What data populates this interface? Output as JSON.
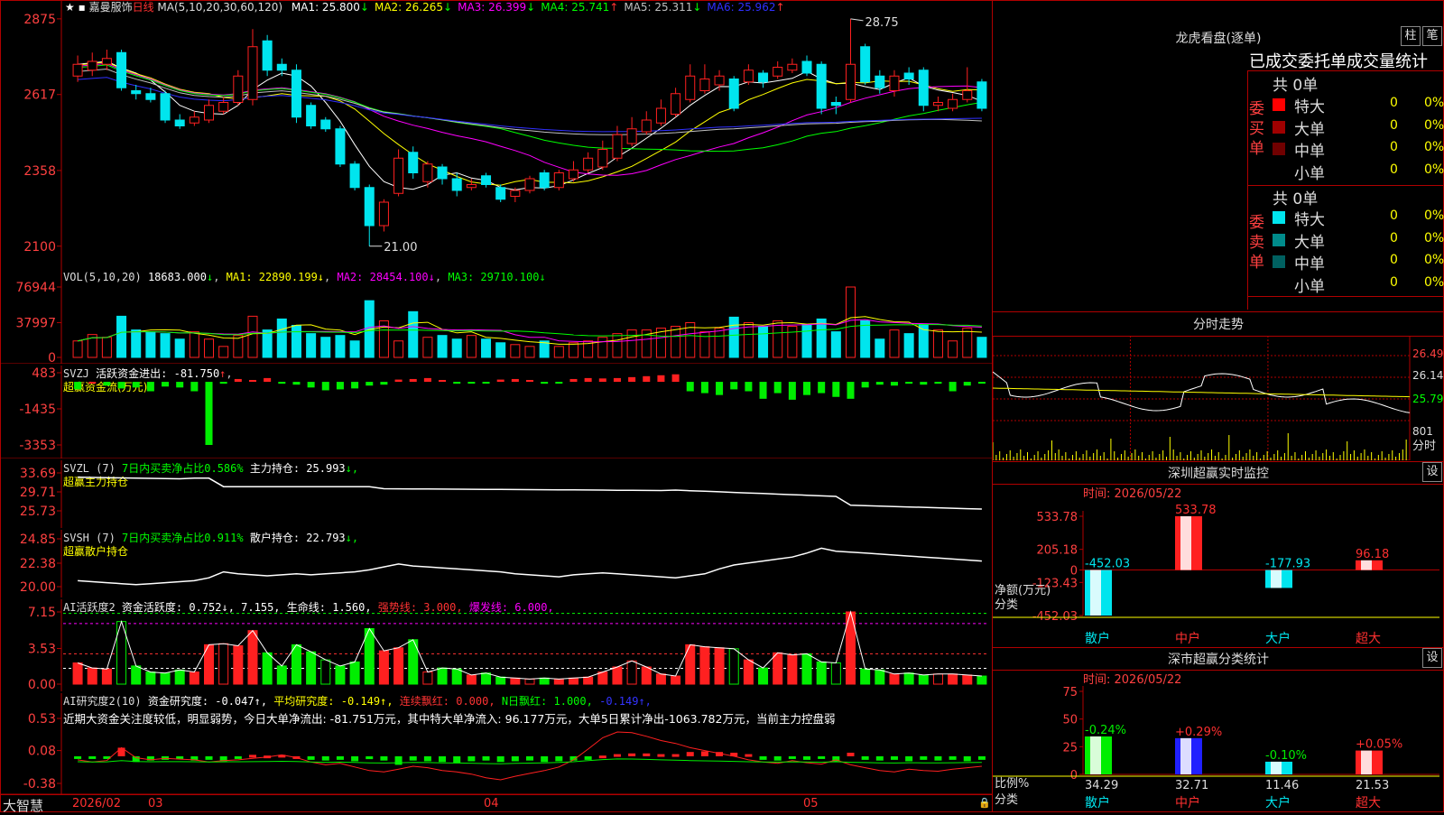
{
  "app": {
    "brand": "大智慧",
    "stock_name": "嘉曼服饰",
    "period": "日线"
  },
  "main_chart": {
    "ma_line": {
      "prefix": "MA(5,10,20,30,60,120)",
      "items": [
        {
          "label": "MA1:",
          "value": "25.800",
          "arrow": "↓",
          "color": "#ffffff"
        },
        {
          "label": "MA2:",
          "value": "26.265",
          "arrow": "↓",
          "color": "#ffff00"
        },
        {
          "label": "MA3:",
          "value": "26.399",
          "arrow": "↓",
          "color": "#ff00ff"
        },
        {
          "label": "MA4:",
          "value": "25.741",
          "arrow": "↑",
          "color": "#00ff00"
        },
        {
          "label": "MA5:",
          "value": "25.311",
          "arrow": "↓",
          "color": "#c0c0c0"
        },
        {
          "label": "MA6:",
          "value": "25.962",
          "arrow": "↑",
          "color": "#3030ff"
        }
      ]
    },
    "y_ticks": [
      "2875",
      "2617",
      "2358",
      "2100"
    ],
    "high_label": "28.75",
    "low_label": "21.00"
  },
  "chart_data": [
    {
      "type": "candlestick",
      "title": "嘉曼服饰 日线",
      "ylim": [
        21.0,
        28.75
      ],
      "high": 28.75,
      "low": 21.0,
      "candles": [
        {
          "o": 26.8,
          "c": 27.2,
          "h": 27.5,
          "l": 26.6
        },
        {
          "o": 27.0,
          "c": 27.3,
          "h": 27.6,
          "l": 26.8
        },
        {
          "o": 27.2,
          "c": 27.4,
          "h": 27.7,
          "l": 27.0
        },
        {
          "o": 27.6,
          "c": 26.4,
          "h": 27.7,
          "l": 26.3
        },
        {
          "o": 26.3,
          "c": 26.2,
          "h": 26.5,
          "l": 26.0
        },
        {
          "o": 26.2,
          "c": 26.0,
          "h": 26.4,
          "l": 25.9
        },
        {
          "o": 26.2,
          "c": 25.3,
          "h": 26.3,
          "l": 25.2
        },
        {
          "o": 25.3,
          "c": 25.1,
          "h": 25.5,
          "l": 25.0
        },
        {
          "o": 25.2,
          "c": 25.4,
          "h": 25.6,
          "l": 25.1
        },
        {
          "o": 25.3,
          "c": 25.8,
          "h": 26.0,
          "l": 25.2
        },
        {
          "o": 25.6,
          "c": 25.9,
          "h": 26.1,
          "l": 25.5
        },
        {
          "o": 25.9,
          "c": 26.8,
          "h": 27.0,
          "l": 25.8
        },
        {
          "o": 26.0,
          "c": 27.8,
          "h": 28.4,
          "l": 25.8
        },
        {
          "o": 28.0,
          "c": 27.0,
          "h": 28.2,
          "l": 26.8
        },
        {
          "o": 27.2,
          "c": 27.0,
          "h": 27.4,
          "l": 26.8
        },
        {
          "o": 27.0,
          "c": 25.4,
          "h": 27.2,
          "l": 25.2
        },
        {
          "o": 25.8,
          "c": 25.1,
          "h": 25.9,
          "l": 25.0
        },
        {
          "o": 25.3,
          "c": 25.0,
          "h": 25.4,
          "l": 24.9
        },
        {
          "o": 25.0,
          "c": 23.8,
          "h": 25.1,
          "l": 23.7
        },
        {
          "o": 23.8,
          "c": 23.0,
          "h": 23.9,
          "l": 22.9
        },
        {
          "o": 23.0,
          "c": 21.7,
          "h": 23.1,
          "l": 21.0
        },
        {
          "o": 21.7,
          "c": 22.5,
          "h": 22.6,
          "l": 21.5
        },
        {
          "o": 22.8,
          "c": 24.0,
          "h": 24.3,
          "l": 22.7
        },
        {
          "o": 24.2,
          "c": 23.5,
          "h": 24.4,
          "l": 23.3
        },
        {
          "o": 23.2,
          "c": 23.8,
          "h": 23.9,
          "l": 23.0
        },
        {
          "o": 23.7,
          "c": 23.3,
          "h": 23.8,
          "l": 23.1
        },
        {
          "o": 23.3,
          "c": 22.9,
          "h": 23.5,
          "l": 22.7
        },
        {
          "o": 23.0,
          "c": 23.1,
          "h": 23.3,
          "l": 22.9
        },
        {
          "o": 23.4,
          "c": 23.1,
          "h": 23.5,
          "l": 23.0
        },
        {
          "o": 23.0,
          "c": 22.6,
          "h": 23.1,
          "l": 22.5
        },
        {
          "o": 22.7,
          "c": 22.9,
          "h": 23.0,
          "l": 22.5
        },
        {
          "o": 22.9,
          "c": 23.3,
          "h": 23.4,
          "l": 22.8
        },
        {
          "o": 23.5,
          "c": 23.0,
          "h": 23.6,
          "l": 22.9
        },
        {
          "o": 23.0,
          "c": 23.5,
          "h": 23.6,
          "l": 22.9
        },
        {
          "o": 23.3,
          "c": 23.6,
          "h": 23.9,
          "l": 23.2
        },
        {
          "o": 23.6,
          "c": 24.0,
          "h": 24.2,
          "l": 23.5
        },
        {
          "o": 23.7,
          "c": 24.3,
          "h": 24.6,
          "l": 23.6
        },
        {
          "o": 24.0,
          "c": 24.8,
          "h": 25.1,
          "l": 23.9
        },
        {
          "o": 24.5,
          "c": 25.0,
          "h": 25.4,
          "l": 24.4
        },
        {
          "o": 24.9,
          "c": 25.3,
          "h": 25.6,
          "l": 24.8
        },
        {
          "o": 25.2,
          "c": 25.7,
          "h": 26.0,
          "l": 25.1
        },
        {
          "o": 25.5,
          "c": 26.2,
          "h": 26.4,
          "l": 25.4
        },
        {
          "o": 26.0,
          "c": 26.8,
          "h": 27.2,
          "l": 25.9
        },
        {
          "o": 26.3,
          "c": 26.7,
          "h": 27.2,
          "l": 26.2
        },
        {
          "o": 26.5,
          "c": 26.8,
          "h": 27.0,
          "l": 26.3
        },
        {
          "o": 26.7,
          "c": 25.7,
          "h": 26.8,
          "l": 25.6
        },
        {
          "o": 26.6,
          "c": 27.0,
          "h": 27.2,
          "l": 26.5
        },
        {
          "o": 26.9,
          "c": 26.6,
          "h": 27.0,
          "l": 26.4
        },
        {
          "o": 26.8,
          "c": 27.1,
          "h": 27.3,
          "l": 26.7
        },
        {
          "o": 27.0,
          "c": 27.2,
          "h": 27.4,
          "l": 26.9
        },
        {
          "o": 27.3,
          "c": 26.9,
          "h": 27.5,
          "l": 26.8
        },
        {
          "o": 27.2,
          "c": 25.7,
          "h": 27.3,
          "l": 25.5
        },
        {
          "o": 25.9,
          "c": 25.8,
          "h": 26.1,
          "l": 25.5
        },
        {
          "o": 26.0,
          "c": 27.2,
          "h": 28.75,
          "l": 25.9
        },
        {
          "o": 27.8,
          "c": 26.6,
          "h": 27.9,
          "l": 26.5
        },
        {
          "o": 26.8,
          "c": 26.4,
          "h": 27.0,
          "l": 26.2
        },
        {
          "o": 26.3,
          "c": 26.8,
          "h": 27.0,
          "l": 26.1
        },
        {
          "o": 26.9,
          "c": 26.7,
          "h": 27.1,
          "l": 26.5
        },
        {
          "o": 27.0,
          "c": 25.8,
          "h": 27.1,
          "l": 25.6
        },
        {
          "o": 25.8,
          "c": 25.9,
          "h": 26.1,
          "l": 25.6
        },
        {
          "o": 25.7,
          "c": 26.0,
          "h": 26.2,
          "l": 25.6
        },
        {
          "o": 26.0,
          "c": 26.3,
          "h": 27.1,
          "l": 25.9
        },
        {
          "o": 26.6,
          "c": 25.7,
          "h": 26.7,
          "l": 25.6
        }
      ]
    },
    {
      "type": "bar",
      "title": "VOL(5,10,20)",
      "ylim": [
        0,
        76944
      ],
      "values": [
        18000,
        25000,
        22000,
        45000,
        30000,
        28000,
        26000,
        20000,
        28000,
        20000,
        12000,
        24000,
        45000,
        30000,
        42000,
        35000,
        26000,
        22000,
        24000,
        18000,
        62000,
        40000,
        18000,
        50000,
        22000,
        24000,
        20000,
        24000,
        20000,
        16000,
        14000,
        12000,
        18000,
        12000,
        16000,
        18000,
        22000,
        26000,
        30000,
        30000,
        32000,
        34000,
        38000,
        28000,
        32000,
        44000,
        38000,
        34000,
        40000,
        34000,
        36000,
        42000,
        28000,
        76944,
        40000,
        20000,
        30000,
        26000,
        36000,
        30000,
        18000,
        32000,
        22000
      ]
    }
  ],
  "vol_panel": {
    "label": "VOL(5,10,20)",
    "value": "18683.000",
    "arrow": "↓",
    "ma1": "MA1: 22890.199↓",
    "ma2": "MA2: 28454.100↓",
    "ma3": "MA3: 29710.100↓",
    "y_ticks": [
      "76944",
      "37997",
      "0"
    ]
  },
  "svzj_panel": {
    "label": "SVZJ",
    "text": "活跃资金进出: -81.750",
    "arrow": "↑",
    "sub": "超赢资金流(万元)",
    "y_ticks": [
      "483",
      "-1435",
      "-3353"
    ],
    "values": [
      -400,
      0,
      -200,
      -350,
      -300,
      -500,
      -250,
      -300,
      -500,
      -3353,
      -100,
      150,
      100,
      200,
      -100,
      -150,
      -300,
      -450,
      -400,
      -350,
      -200,
      -150,
      120,
      150,
      200,
      100,
      -100,
      -80,
      -60,
      120,
      150,
      100,
      -100,
      -80,
      150,
      200,
      180,
      200,
      250,
      300,
      350,
      400,
      -500,
      -600,
      -700,
      -400,
      -500,
      -900,
      -600,
      -950,
      -700,
      -600,
      -800,
      -900,
      -300,
      -150,
      -200,
      -100,
      -150,
      -100,
      -500,
      -200,
      -82
    ]
  },
  "svzl_panel": {
    "label": "SVZL (7)",
    "text1": "7日内买卖净占比0.586%",
    "text2": "主力持仓: 25.993",
    "arrow": "↓,",
    "sub": "超赢主力持仓",
    "y_ticks": [
      "33.69",
      "29.71",
      "25.73"
    ]
  },
  "svsh_panel": {
    "label": "SVSH (7)",
    "text1": "7日内买卖净占比0.911%",
    "text2": "散户持仓: 22.793",
    "arrow": "↓,",
    "sub": "超赢散户持仓",
    "y_ticks": [
      "24.85",
      "22.38",
      "20.00"
    ]
  },
  "ai_active_panel": {
    "label": "AI活跃度2",
    "t1": "资金活跃度: 0.752↓, 7.155,",
    "t2": "生命线: 1.560,",
    "t3": "强势线: 3.000,",
    "t4": "爆发线: 6.000,",
    "y_ticks": [
      "7.15",
      "3.53",
      "0.00"
    ]
  },
  "ai_research_panel": {
    "label": "AI研究度2(10)",
    "t1": "资金研究度: -0.047↑,",
    "t2": "平均研究度: -0.149↑,",
    "t3": "连续飘红: 0.000,",
    "t4": "N日飘红: 1.000,",
    "t5": "-0.149↑,",
    "comment": "近期大资金关注度较低，明显弱势，今日大单净流出: -81.751万元，其中特大单净流入: 96.177万元，大单5日累计净出-1063.782万元，当前主力控盘弱",
    "y_ticks": [
      "0.53",
      "0.08",
      "-0.38"
    ]
  },
  "time_axis": [
    "2026/02",
    "03",
    "04",
    "05"
  ],
  "right_panel": {
    "lhkp": {
      "title": "龙虎看盘(逐单)",
      "btn1": "柱",
      "btn2": "笔",
      "header": "已成交委托单成交量统计",
      "buy_label": "委买单",
      "sell_label": "委卖单",
      "buy_total": "共 0单",
      "sell_total": "共 0单",
      "buy_rows": [
        {
          "name": "特大",
          "count": "0",
          "pct": "0%",
          "color": "#ff0000"
        },
        {
          "name": "大单",
          "count": "0",
          "pct": "0%",
          "color": "#a00000"
        },
        {
          "name": "中单",
          "count": "0",
          "pct": "0%",
          "color": "#700000"
        },
        {
          "name": "小单",
          "count": "0",
          "pct": "0%",
          "color": ""
        }
      ],
      "sell_rows": [
        {
          "name": "特大",
          "count": "0",
          "pct": "0%",
          "color": "#00e5ee"
        },
        {
          "name": "大单",
          "count": "0",
          "pct": "0%",
          "color": "#008b8b"
        },
        {
          "name": "中单",
          "count": "0",
          "pct": "0%",
          "color": "#006060"
        },
        {
          "name": "小单",
          "count": "0",
          "pct": "0%",
          "color": ""
        }
      ]
    },
    "intraday": {
      "title": "分时走势",
      "y_ticks": [
        "26.49",
        "26.14",
        "25.79"
      ],
      "vol_label": "801",
      "time_label": "分时"
    },
    "sz_monitor": {
      "title": "深圳超赢实时监控",
      "settings": "设",
      "date": "时间: 2026/05/22",
      "y_ticks": [
        "533.78",
        "205.18",
        "0",
        "-123.43",
        "-452.03"
      ],
      "ylabel": "净额(万元)",
      "xlabel": "分类",
      "categories": [
        "散户",
        "中户",
        "大户",
        "超大"
      ],
      "values": [
        -452.03,
        533.78,
        -177.93,
        96.18
      ],
      "value_labels": [
        "-452.03",
        "533.78",
        "-177.93",
        "96.18"
      ]
    },
    "sz_class": {
      "title": "深市超赢分类统计",
      "settings": "设",
      "date": "时间: 2026/05/22",
      "y_ticks": [
        "75",
        "50",
        "25",
        "0"
      ],
      "ylabel": "比例%",
      "xlabel": "分类",
      "categories": [
        "散户",
        "中户",
        "大户",
        "超大"
      ],
      "values": [
        34.29,
        32.71,
        11.46,
        21.53
      ],
      "value_labels": [
        "34.29",
        "32.71",
        "11.46",
        "21.53"
      ],
      "change_labels": [
        "-0.24%",
        "+0.29%",
        "-0.10%",
        "+0.05%"
      ]
    }
  },
  "colors": {
    "up": "#ff2020",
    "down": "#00e5ee",
    "frame": "#b00000",
    "axis_text": "#ff4040"
  }
}
